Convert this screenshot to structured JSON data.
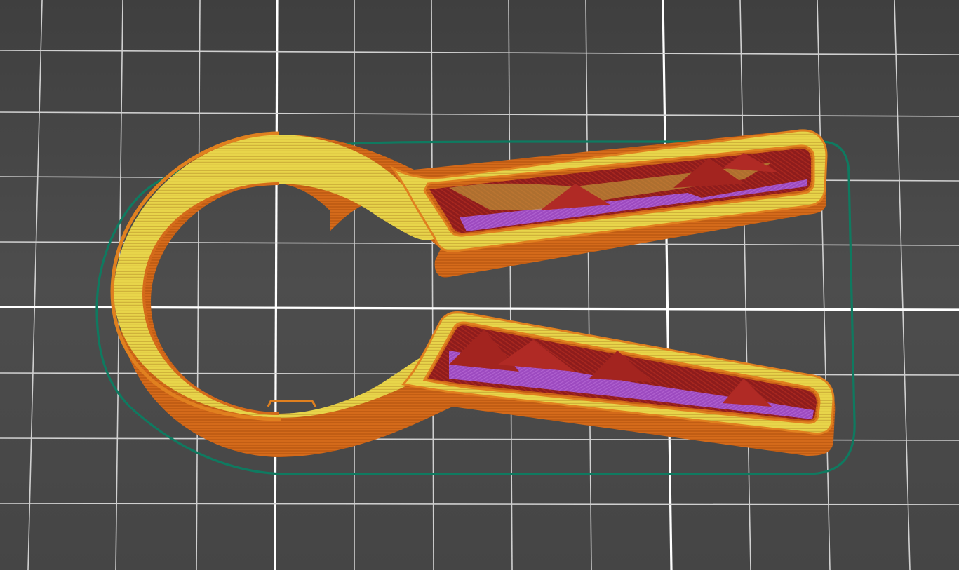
{
  "scene": {
    "view": "gcode-preview",
    "object": "jar-opener-wrench",
    "colors": {
      "bed": "#4b4b4b",
      "bed_shade": "#414141",
      "grid_minor": "#cfcfcf",
      "grid_major": "#ffffff",
      "skirt": "#0f7a60",
      "perimeter": "#d9721d",
      "perimeter_dark": "#b85712",
      "external_perimeter": "#e08a2a",
      "inner_perimeter": "#e6d045",
      "infill": "#8e1c1c",
      "infill_light": "#b02a25",
      "solid_infill": "#a052d6"
    },
    "features": [
      "skirt",
      "external-perimeter",
      "perimeter",
      "internal-infill",
      "solid-infill"
    ]
  }
}
